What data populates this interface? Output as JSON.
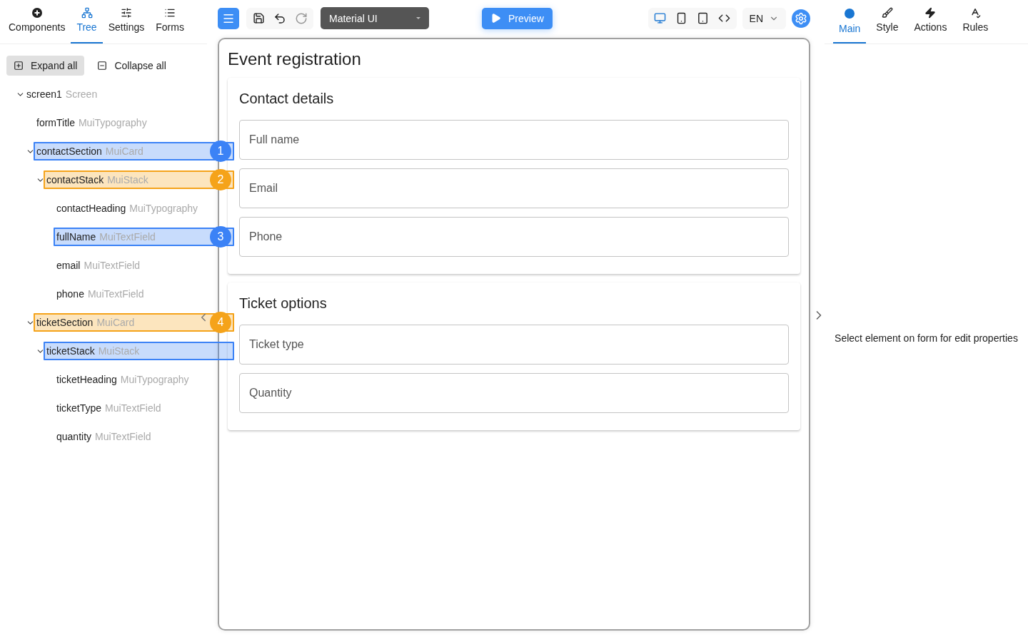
{
  "left_tabs": [
    {
      "label": "Components",
      "selected": false
    },
    {
      "label": "Tree",
      "selected": true
    },
    {
      "label": "Settings",
      "selected": false
    },
    {
      "label": "Forms",
      "selected": false
    }
  ],
  "tree_actions": [
    {
      "label": "Expand all",
      "selected": true
    },
    {
      "label": "Collapse all",
      "selected": false
    }
  ],
  "tree": [
    {
      "name": "screen1",
      "type": "Screen",
      "expanded": true,
      "children": [
        {
          "name": "formTitle",
          "type": "MuiTypography"
        },
        {
          "name": "contactSection",
          "type": "MuiCard",
          "expanded": true,
          "highlight": {
            "label": "1",
            "color": "#3b82f6"
          },
          "children": [
            {
              "name": "contactStack",
              "type": "MuiStack",
              "expanded": true,
              "highlight": {
                "label": "2",
                "color": "#f5a31a"
              },
              "children": [
                {
                  "name": "contactHeading",
                  "type": "MuiTypography"
                },
                {
                  "name": "fullName",
                  "type": "MuiTextField",
                  "highlight": {
                    "label": "3",
                    "color": "#3b82f6"
                  }
                },
                {
                  "name": "email",
                  "type": "MuiTextField"
                },
                {
                  "name": "phone",
                  "type": "MuiTextField"
                }
              ]
            }
          ]
        },
        {
          "name": "ticketSection",
          "type": "MuiCard",
          "expanded": true,
          "highlight": {
            "label": "4",
            "color": "#f5a31a"
          },
          "children": [
            {
              "name": "ticketStack",
              "type": "MuiStack",
              "expanded": true,
              "highlight": {
                "color": "#3b82f6"
              },
              "children": [
                {
                  "name": "ticketHeading",
                  "type": "MuiTypography"
                },
                {
                  "name": "ticketType",
                  "type": "MuiTextField"
                },
                {
                  "name": "quantity",
                  "type": "MuiTextField"
                }
              ]
            }
          ]
        }
      ]
    }
  ],
  "toolbar": {
    "history": [
      {
        "disabled": false
      },
      {
        "disabled": false
      },
      {
        "disabled": true
      }
    ],
    "library": "Material UI",
    "preview": "Preview",
    "devices": [
      {
        "selected": true
      },
      {
        "selected": false
      },
      {
        "selected": false
      },
      {
        "selected": false
      }
    ],
    "language": "EN"
  },
  "form": {
    "title": "Event registration",
    "sections": [
      {
        "heading": "Contact details",
        "fields": [
          {
            "placeholder": "Full name"
          },
          {
            "placeholder": "Email"
          },
          {
            "placeholder": "Phone"
          }
        ]
      },
      {
        "heading": "Ticket options",
        "fields": [
          {
            "placeholder": "Ticket type"
          },
          {
            "placeholder": "Quantity"
          }
        ]
      }
    ]
  },
  "right_tabs": [
    {
      "label": "Main",
      "selected": true
    },
    {
      "label": "Style",
      "selected": false
    },
    {
      "label": "Actions",
      "selected": false
    },
    {
      "label": "Rules",
      "selected": false
    }
  ],
  "properties_hint": "Select element on form for edit properties"
}
